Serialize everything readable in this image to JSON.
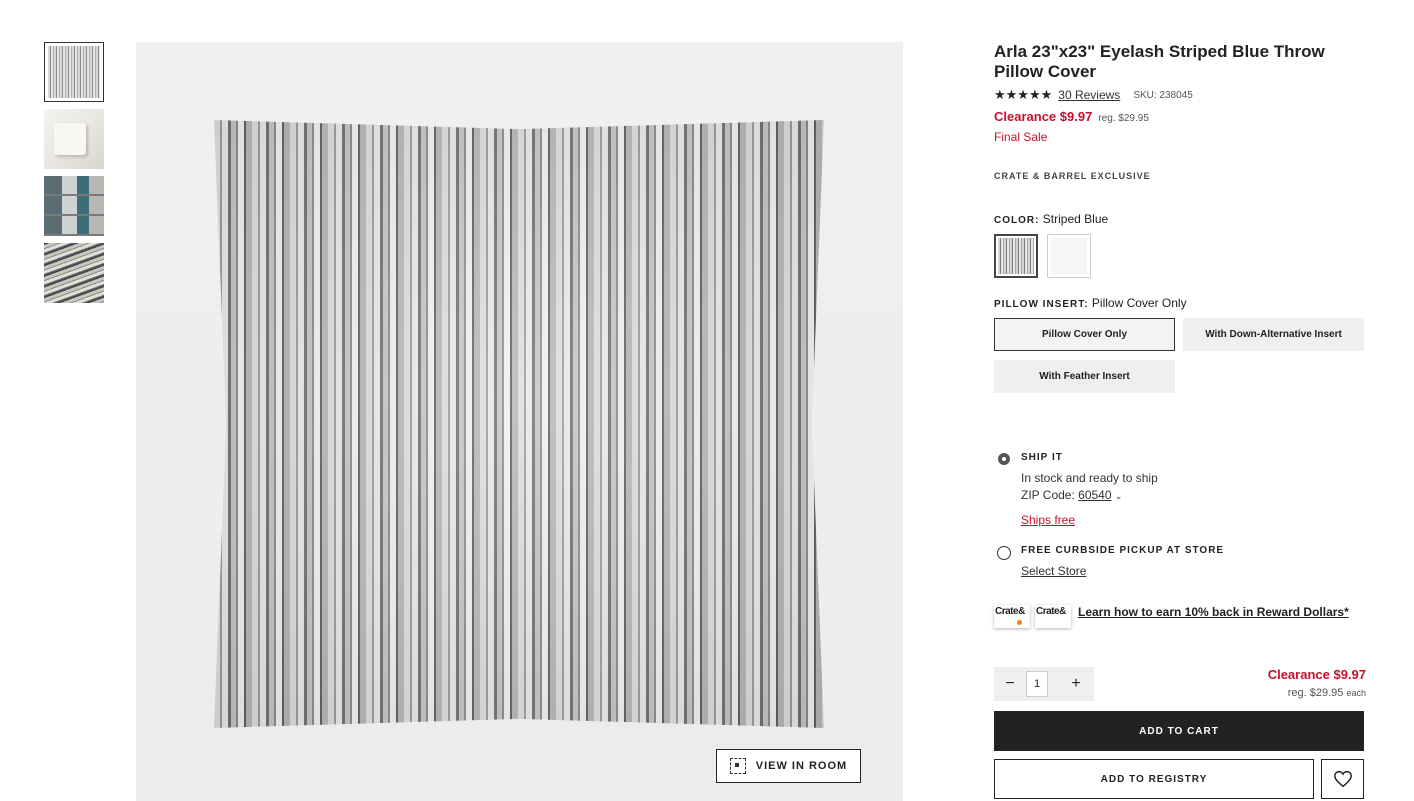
{
  "product": {
    "title": "Arla 23\"x23\" Eyelash Striped Blue Throw Pillow Cover",
    "stars": "★★★★★",
    "reviews": "30 Reviews",
    "sku": "SKU: 238045",
    "clearance": "Clearance $9.97",
    "reg": "reg. $29.95",
    "final_sale": "Final Sale",
    "exclusive": "CRATE & BARREL EXCLUSIVE"
  },
  "image": {
    "view_in_room": "VIEW IN ROOM",
    "thumb_count": 4
  },
  "color": {
    "label": "COLOR:",
    "value": "Striped Blue",
    "swatches": [
      "Striped Blue",
      "White"
    ]
  },
  "insert": {
    "label": "PILLOW INSERT:",
    "value": "Pillow Cover Only",
    "options": [
      "Pillow Cover Only",
      "With Down-Alternative Insert",
      "With Feather Insert"
    ]
  },
  "fulfillment": {
    "ship_label": "SHIP IT",
    "stock": "In stock and ready to ship",
    "zip_label": "ZIP Code:",
    "zip": "60540",
    "ships_free": "Ships free",
    "pickup_label": "FREE CURBSIDE PICKUP AT STORE",
    "select_store": "Select Store"
  },
  "reward": {
    "card_text": "Crate&",
    "link": "Learn how to earn 10% back in Reward Dollars*"
  },
  "purchase": {
    "qty": "1",
    "minus": "−",
    "plus": "+",
    "clearance": "Clearance $9.97",
    "reg": "reg. $29.95",
    "each": "each",
    "add_to_cart": "ADD TO CART",
    "add_to_registry": "ADD TO REGISTRY"
  },
  "colors": {
    "accent_red": "#c8102e",
    "dark": "#222222"
  }
}
